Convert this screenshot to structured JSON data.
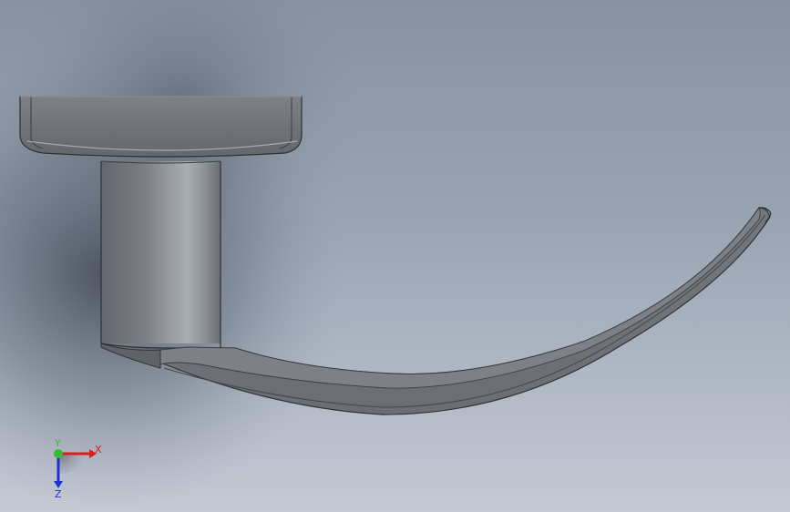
{
  "viewport": {
    "colors": {
      "background_top": "#8592a2",
      "background_bottom": "#c4c9d3",
      "part_face": "#6f7377",
      "part_edge": "#2f3134",
      "part_highlight": "#a7acb1"
    }
  },
  "triad": {
    "x_label": "X",
    "y_label": "Y",
    "z_label": "Z",
    "colors": {
      "x_axis": "#d81e1e",
      "y_axis": "#2fbf2f",
      "z_axis": "#1f2fd0"
    }
  }
}
